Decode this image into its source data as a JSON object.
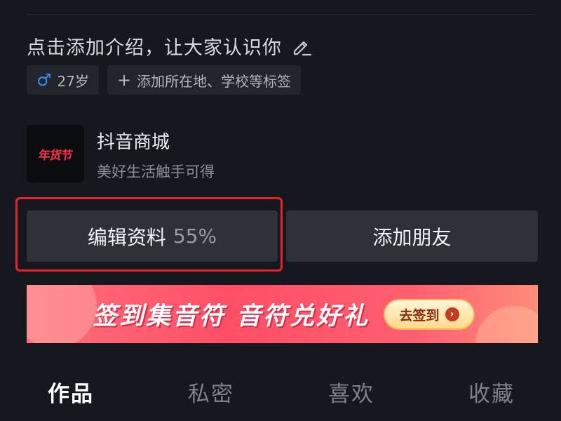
{
  "bio": {
    "text": "点击添加介绍，让大家认识你"
  },
  "tags": {
    "gender_icon": "♂",
    "age": "27岁",
    "add_icon": "+",
    "add_label": "添加所在地、学校等标签"
  },
  "shop": {
    "logo_text": "年货节",
    "name": "抖音商城",
    "subtitle": "美好生活触手可得"
  },
  "actions": {
    "edit_label": "编辑资料",
    "edit_progress": "55%",
    "add_friend_label": "添加朋友"
  },
  "banner": {
    "text": "签到集音符 音符兑好礼",
    "button_label": "去签到",
    "button_icon": "›"
  },
  "tabs": [
    {
      "label": "作品",
      "active": true
    },
    {
      "label": "私密",
      "active": false
    },
    {
      "label": "喜欢",
      "active": false
    },
    {
      "label": "收藏",
      "active": false
    }
  ],
  "colors": {
    "background": "#16181f",
    "button": "#2f3139",
    "gender": "#3d8cf2",
    "highlight": "#e8232b",
    "banner": "#ff4f66"
  }
}
